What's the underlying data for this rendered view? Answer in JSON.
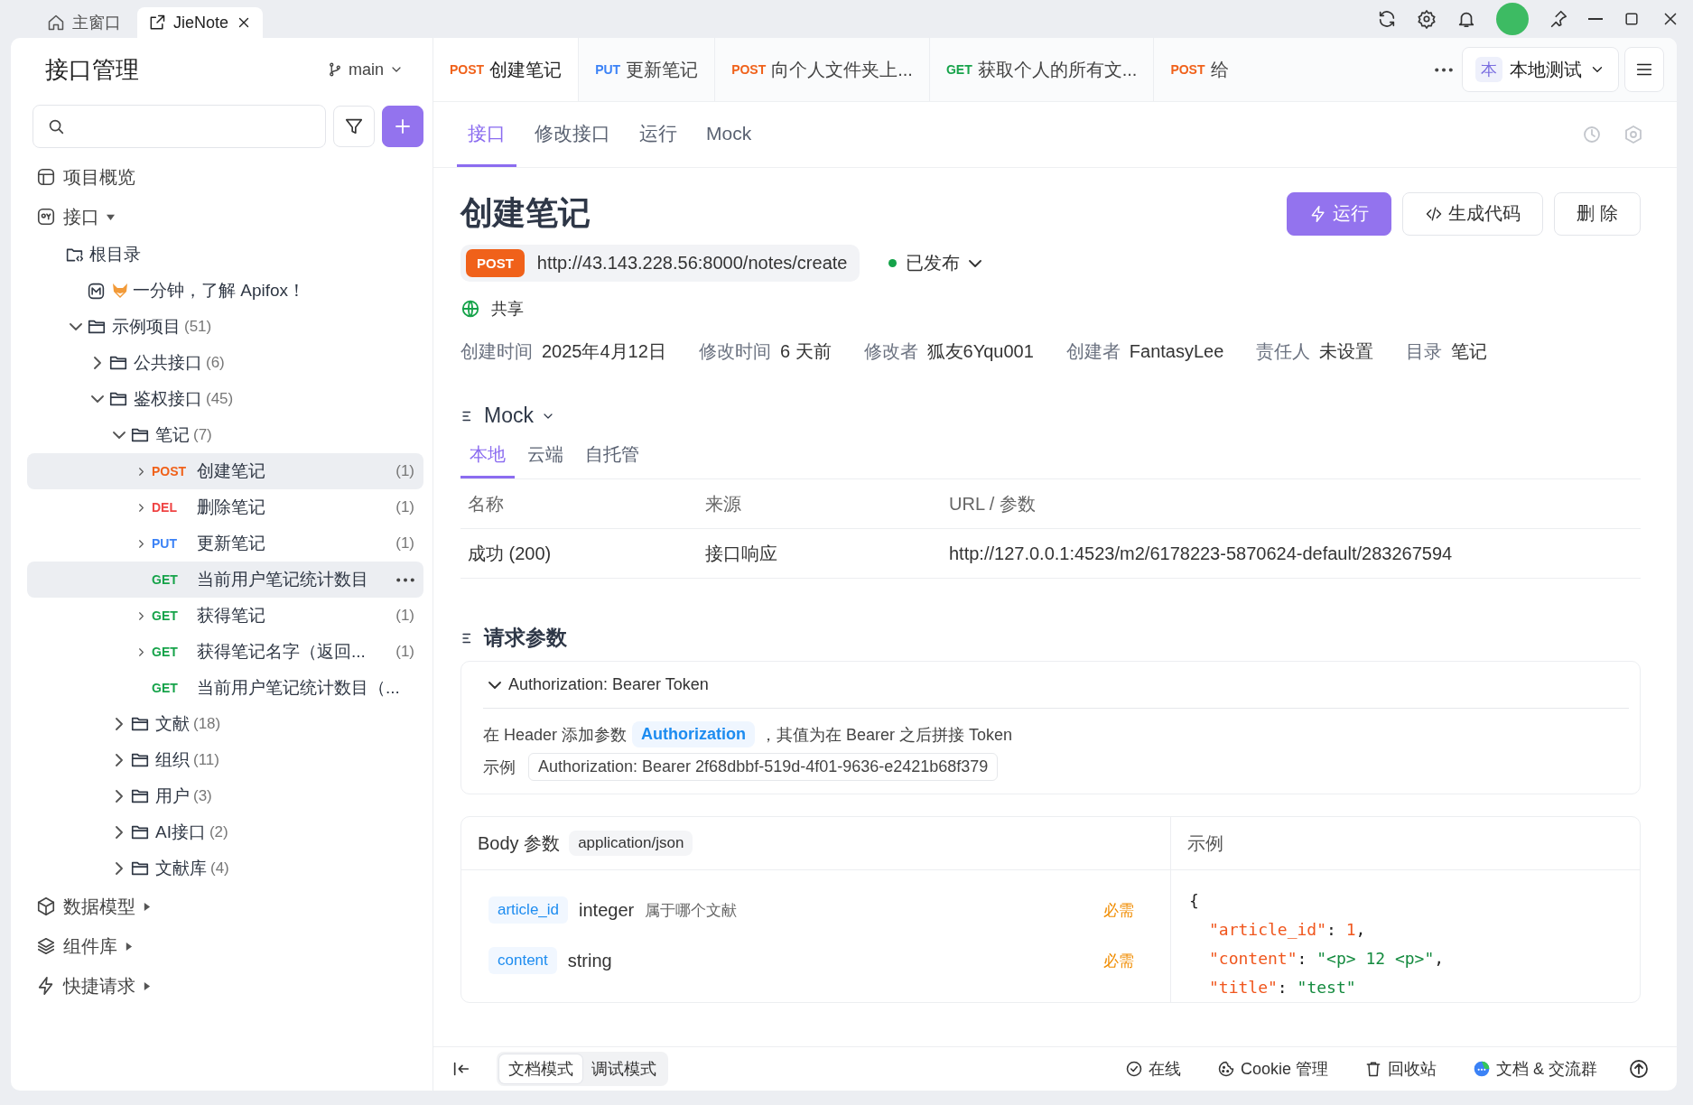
{
  "titlebar": {
    "tabs": [
      {
        "label": "主窗口",
        "kind": "home",
        "selected": false,
        "closable": false
      },
      {
        "label": "JieNote",
        "kind": "external",
        "selected": true,
        "closable": true
      }
    ]
  },
  "sidebar": {
    "title": "接口管理",
    "branch": "main",
    "nav": [
      {
        "kind": "overview",
        "label": "项目概览"
      },
      {
        "kind": "apis",
        "label": "接口",
        "expanded": true,
        "children": [
          {
            "kind": "root",
            "label": "根目录",
            "children": [
              {
                "kind": "doc",
                "label": "一分钟，了解 Apifox！"
              },
              {
                "kind": "folder",
                "label": "示例项目",
                "count": "(51)",
                "expanded": true,
                "children": [
                  {
                    "kind": "folder",
                    "label": "公共接口",
                    "count": "(6)",
                    "expanded": false
                  },
                  {
                    "kind": "folder",
                    "label": "鉴权接口",
                    "count": "(45)",
                    "expanded": true,
                    "children": [
                      {
                        "kind": "folder",
                        "label": "笔记",
                        "count": "(7)",
                        "expanded": true,
                        "children": [
                          {
                            "kind": "endpoint",
                            "method": "POST",
                            "color": "#f0611a",
                            "label": "创建笔记",
                            "count": "(1)",
                            "expandable": true,
                            "selected": true,
                            "hovered": false
                          },
                          {
                            "kind": "endpoint",
                            "method": "DEL",
                            "color": "#ef4444",
                            "label": "删除笔记",
                            "count": "(1)",
                            "expandable": true,
                            "selected": false,
                            "hovered": false
                          },
                          {
                            "kind": "endpoint",
                            "method": "PUT",
                            "color": "#3b82f6",
                            "label": "更新笔记",
                            "count": "(1)",
                            "expandable": true,
                            "selected": false,
                            "hovered": false
                          },
                          {
                            "kind": "endpoint",
                            "method": "GET",
                            "color": "#16a34a",
                            "label": "当前用户笔记统计数目",
                            "expandable": false,
                            "selected": true,
                            "hovered": true
                          },
                          {
                            "kind": "endpoint",
                            "method": "GET",
                            "color": "#16a34a",
                            "label": "获得笔记",
                            "count": "(1)",
                            "expandable": true,
                            "selected": false,
                            "hovered": false
                          },
                          {
                            "kind": "endpoint",
                            "method": "GET",
                            "color": "#16a34a",
                            "label": "获得笔记名字（返回...",
                            "count": "(1)",
                            "expandable": true,
                            "selected": false,
                            "hovered": false
                          },
                          {
                            "kind": "endpoint",
                            "method": "GET",
                            "color": "#16a34a",
                            "label": "当前用户笔记统计数目（...",
                            "expandable": false,
                            "selected": false,
                            "hovered": false
                          }
                        ]
                      },
                      {
                        "kind": "folder",
                        "label": "文献",
                        "count": "(18)",
                        "expanded": false
                      },
                      {
                        "kind": "folder",
                        "label": "组织",
                        "count": "(11)",
                        "expanded": false
                      },
                      {
                        "kind": "folder",
                        "label": "用户",
                        "count": "(3)",
                        "expanded": false
                      },
                      {
                        "kind": "folder",
                        "label": "AI接口",
                        "count": "(2)",
                        "expanded": false
                      },
                      {
                        "kind": "folder",
                        "label": "文献库",
                        "count": "(4)",
                        "expanded": false
                      }
                    ]
                  }
                ]
              }
            ]
          }
        ]
      },
      {
        "kind": "models",
        "label": "数据模型",
        "expanded": false
      },
      {
        "kind": "components",
        "label": "组件库",
        "expanded": false
      },
      {
        "kind": "quick",
        "label": "快捷请求",
        "expanded": false
      }
    ]
  },
  "request_tabs": {
    "items": [
      {
        "method": "POST",
        "color": "#f0611a",
        "label": "创建笔记",
        "selected": true
      },
      {
        "method": "PUT",
        "color": "#3b82f6",
        "label": "更新笔记",
        "selected": false
      },
      {
        "method": "POST",
        "color": "#f0611a",
        "label": "向个人文件夹上...",
        "selected": false
      },
      {
        "method": "GET",
        "color": "#16a34a",
        "label": "获取个人的所有文...",
        "selected": false
      },
      {
        "method": "POST",
        "color": "#f0611a",
        "label": "给",
        "selected": false
      }
    ],
    "environment": {
      "badge": "本",
      "label": "本地测试"
    }
  },
  "view_tabs": [
    {
      "label": "接口",
      "selected": true
    },
    {
      "label": "修改接口",
      "selected": false
    },
    {
      "label": "运行",
      "selected": false
    },
    {
      "label": "Mock",
      "selected": false
    }
  ],
  "endpoint": {
    "title": "创建笔记",
    "actions": [
      {
        "kind": "run",
        "label": "运行"
      },
      {
        "kind": "code",
        "label": "生成代码"
      },
      {
        "kind": "delete",
        "label": "删 除"
      }
    ],
    "method": "POST",
    "url": "http://43.143.228.56:8000/notes/create",
    "status": {
      "label": "已发布",
      "color": "#16a34a"
    },
    "visibility": "共享",
    "meta": [
      {
        "label": "创建时间",
        "value": "2025年4月12日"
      },
      {
        "label": "修改时间",
        "value": "6 天前"
      },
      {
        "label": "修改者",
        "value": "狐友6Yqu001"
      },
      {
        "label": "创建者",
        "value": "FantasyLee"
      },
      {
        "label": "责任人",
        "value": "未设置"
      },
      {
        "label": "目录",
        "value": "笔记"
      }
    ]
  },
  "mock": {
    "title": "Mock",
    "tabs": [
      {
        "label": "本地",
        "selected": true
      },
      {
        "label": "云端",
        "selected": false
      },
      {
        "label": "自托管",
        "selected": false
      }
    ],
    "columns": [
      "名称",
      "来源",
      "URL / 参数"
    ],
    "rows": [
      [
        "成功 (200)",
        "接口响应",
        "http://127.0.0.1:4523/m2/6178223-5870624-default/283267594"
      ]
    ]
  },
  "request_params": {
    "title": "请求参数",
    "auth": {
      "title": "Authorization: Bearer Token",
      "expanded": true,
      "text_before": "在 Header 添加参数",
      "param": "Authorization",
      "text_after": "，其值为在 Bearer 之后拼接 Token",
      "example_label": "示例",
      "example": "Authorization: Bearer 2f68dbbf-519d-4f01-9636-e2421b68f379"
    },
    "body": {
      "title": "Body 参数",
      "content_type": "application/json",
      "example_title": "示例",
      "fields": [
        {
          "name": "article_id",
          "type": "integer",
          "description": "属于哪个文献",
          "required": "必需"
        },
        {
          "name": "content",
          "type": "string",
          "required": "必需"
        }
      ],
      "example_lines": [
        {
          "indented": false,
          "parts": [
            {
              "kind": "punct",
              "text": "{"
            }
          ]
        },
        {
          "indented": true,
          "parts": [
            {
              "kind": "key",
              "text": "\"article_id\""
            },
            {
              "kind": "punct",
              "text": ": "
            },
            {
              "kind": "number",
              "text": "1"
            },
            {
              "kind": "punct",
              "text": ","
            }
          ]
        },
        {
          "indented": true,
          "parts": [
            {
              "kind": "key",
              "text": "\"content\""
            },
            {
              "kind": "punct",
              "text": ": "
            },
            {
              "kind": "string",
              "text": "\"<p> 12 <p>\""
            },
            {
              "kind": "punct",
              "text": ","
            }
          ]
        },
        {
          "indented": true,
          "parts": [
            {
              "kind": "key",
              "text": "\"title\""
            },
            {
              "kind": "punct",
              "text": ": "
            },
            {
              "kind": "string",
              "text": "\"test\""
            }
          ]
        }
      ]
    }
  },
  "status_bar": {
    "modes": [
      {
        "label": "文档模式",
        "selected": true
      },
      {
        "label": "调试模式",
        "selected": false
      }
    ],
    "items": [
      {
        "kind": "online",
        "label": "在线"
      },
      {
        "kind": "cookie",
        "label": "Cookie 管理"
      },
      {
        "kind": "trash",
        "label": "回收站"
      },
      {
        "kind": "community",
        "label": "文档 & 交流群"
      }
    ]
  }
}
